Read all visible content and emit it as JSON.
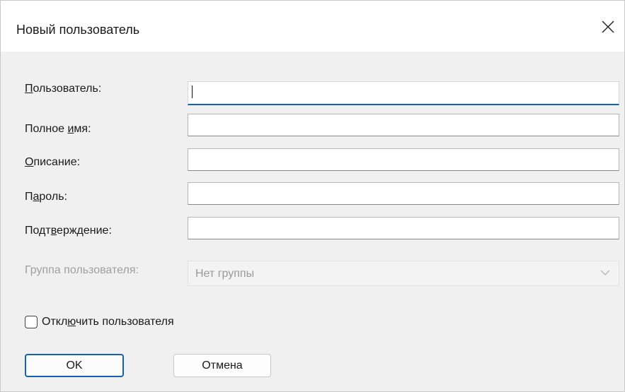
{
  "dialog": {
    "title": "Новый пользователь",
    "close_glyph": "close-icon"
  },
  "form": {
    "username": {
      "label": "Пользователь:",
      "value": "",
      "placeholder": ""
    },
    "fullname": {
      "label_pre": "Полное ",
      "label_u": "и",
      "label_post": "мя:",
      "value": ""
    },
    "description": {
      "label_u": "О",
      "label_post": "писание:",
      "value": ""
    },
    "password": {
      "label_pre": "П",
      "label_u": "а",
      "label_post": "роль:",
      "value": ""
    },
    "confirm": {
      "label_pre": "Подт",
      "label_u": "в",
      "label_post": "ерждение:",
      "value": ""
    },
    "group": {
      "label": "Группа пользователя:",
      "selected": "Нет группы"
    },
    "disable_user": {
      "label_pre": "Откл",
      "label_u": "ю",
      "label_post": "чить пользователя",
      "checked": false
    }
  },
  "buttons": {
    "ok": "OK",
    "cancel": "Отмена"
  },
  "colors": {
    "accent": "#0f62b5",
    "window_bg": "#f0f0f0",
    "disabled_text": "#a0a0a0"
  }
}
